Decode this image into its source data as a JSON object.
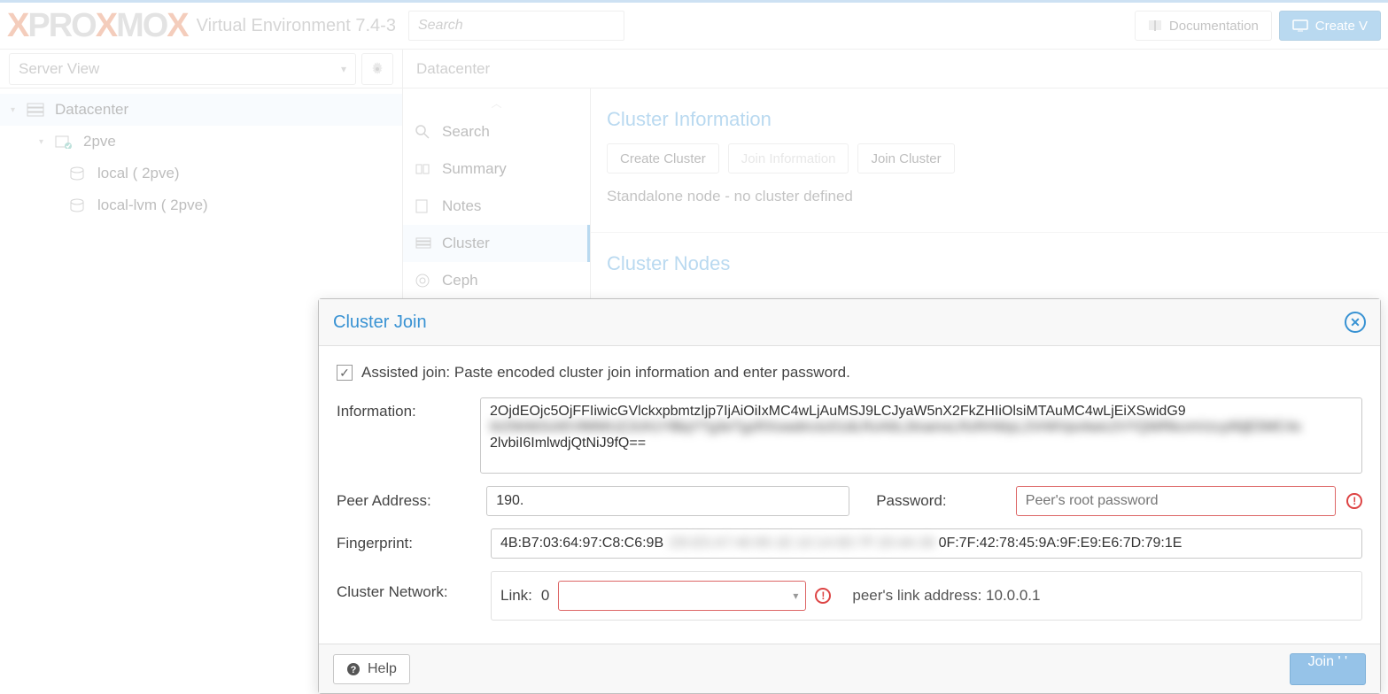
{
  "header": {
    "logo_text_1": "PRO",
    "logo_text_2": "MO",
    "env_label": "Virtual Environment 7.4-3",
    "search_placeholder": "Search",
    "documentation_label": "Documentation",
    "create_vm_label": "Create V"
  },
  "sidebar": {
    "view_label": "Server View",
    "tree": {
      "root": "Datacenter",
      "node": "2pve",
      "storage1": "local (   2pve)",
      "storage2": "local-lvm (   2pve)"
    }
  },
  "content": {
    "title": "Datacenter",
    "nav": {
      "search": "Search",
      "summary": "Summary",
      "notes": "Notes",
      "cluster": "Cluster",
      "ceph": "Ceph"
    },
    "cluster": {
      "section_info": "Cluster Information",
      "create_btn": "Create Cluster",
      "join_info_btn": "Join Information",
      "join_cluster_btn": "Join Cluster",
      "standalone_msg": "Standalone node - no cluster defined",
      "section_nodes": "Cluster Nodes"
    }
  },
  "dialog": {
    "title": "Cluster Join",
    "assist_label": "Assisted join: Paste encoded cluster join information and enter password.",
    "info_label": "Information:",
    "info_value_line1": "2OjdEOjc5OjFFIiwicGVlckxpbmtzIjp7IjAiOiIxMC4wLjAuMSJ9LCJyaW5nX2FkZHIiOlsiMTAuMC4wLjEiXSwidG9",
    "info_value_line3": "2lvbiI6ImlwdjQtNiJ9fQ==",
    "peer_label": "Peer Address:",
    "peer_value": "190.",
    "pw_label": "Password:",
    "pw_placeholder": "Peer's root password",
    "fp_label": "Fingerprint:",
    "fp_value_start": "4B:B7:03:64:97:C8:C6:9B",
    "fp_value_end": "0F:7F:42:78:45:9A:9F:E9:E6:7D:79:1E",
    "cnet_label": "Cluster Network:",
    "link_label": "Link:",
    "link_num": "0",
    "link_hint": "peer's link address: 10.0.0.1",
    "help_label": "Help",
    "join_btn_label": "Join '          '"
  }
}
